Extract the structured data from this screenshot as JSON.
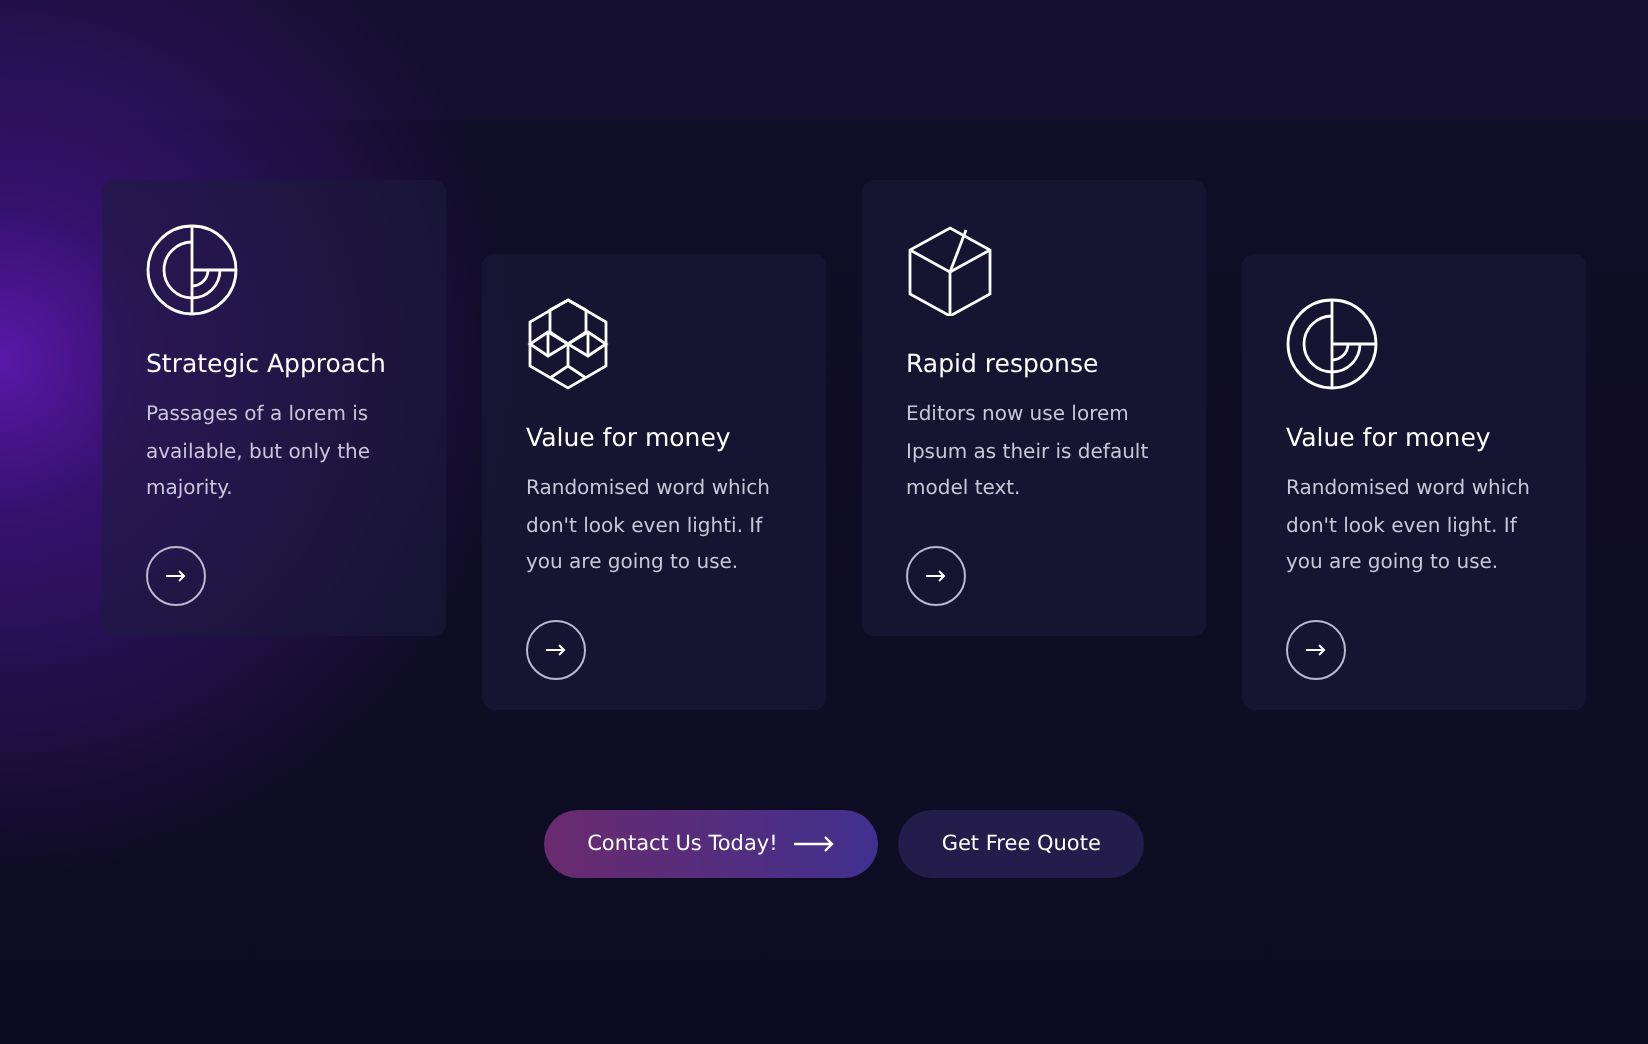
{
  "cards": [
    {
      "kind": "target",
      "title": "Strategic Approach",
      "text": "Passages of a lorem is available, but only the majority."
    },
    {
      "kind": "cubes",
      "title": "Value for money",
      "text": "Randomised word which don't look even lighti. If you are going to use."
    },
    {
      "kind": "hexagon",
      "title": "Rapid response",
      "text": "Editors now use lorem Ipsum as their is default model text."
    },
    {
      "kind": "target",
      "title": "Value for money",
      "text": "Randomised word which don't look even light. If you are going to use."
    }
  ],
  "buttons": [
    {
      "kind": "primary",
      "label": "Contact Us Today!"
    },
    {
      "kind": "secondary",
      "label": "Get Free Quote"
    }
  ]
}
